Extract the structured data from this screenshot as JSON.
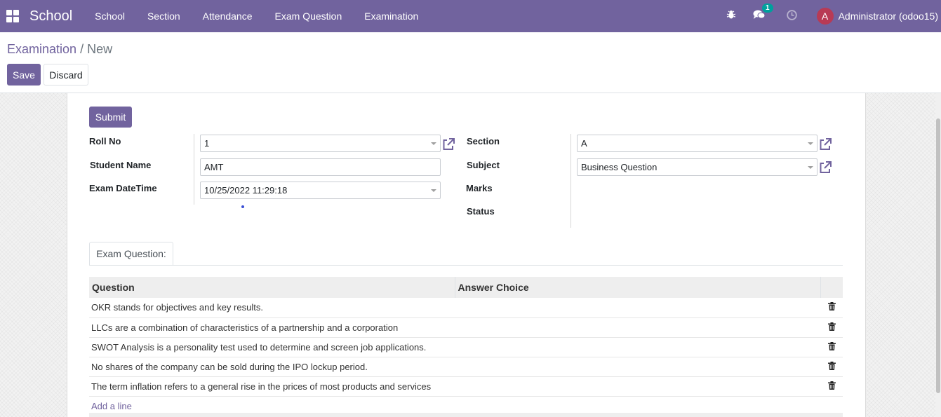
{
  "navbar": {
    "brand": "School",
    "menu": [
      "School",
      "Section",
      "Attendance",
      "Exam Question",
      "Examination"
    ],
    "message_count": "1",
    "avatar_letter": "A",
    "user": "Administrator (odoo15)",
    "icons": [
      "apps-icon",
      "bug-icon",
      "chat-icon",
      "clock-icon"
    ]
  },
  "breadcrumb": {
    "parent": "Examination",
    "separator": "/",
    "current": "New"
  },
  "buttons": {
    "save": "Save",
    "discard": "Discard",
    "submit": "Submit"
  },
  "form": {
    "roll_no_label": "Roll No",
    "roll_no_value": "1",
    "student_name_label": "Student Name",
    "student_name_value": "AMT",
    "exam_datetime_label": "Exam DateTime",
    "exam_datetime_value": "10/25/2022 11:29:18",
    "section_label": "Section",
    "section_value": "A",
    "subject_label": "Subject",
    "subject_value": "Business Question",
    "marks_label": "Marks",
    "status_label": "Status"
  },
  "tab": {
    "label": "Exam Question:"
  },
  "table": {
    "headers": [
      "Question",
      "Answer Choice"
    ],
    "rows": [
      {
        "question": "OKR stands for objectives and key results.",
        "answer": ""
      },
      {
        "question": "LLCs are a combination of characteristics of a partnership and a corporation",
        "answer": ""
      },
      {
        "question": "SWOT Analysis is a personality test used to determine and screen job applications.",
        "answer": ""
      },
      {
        "question": "No shares of the company can be sold during the IPO lockup period.",
        "answer": ""
      },
      {
        "question": "The term inflation refers to a general rise in the prices of most products and services",
        "answer": ""
      }
    ],
    "add_line": "Add a line"
  },
  "colors": {
    "primary": "#71639e",
    "badge": "#00a09d",
    "avatar": "#b83a55"
  }
}
